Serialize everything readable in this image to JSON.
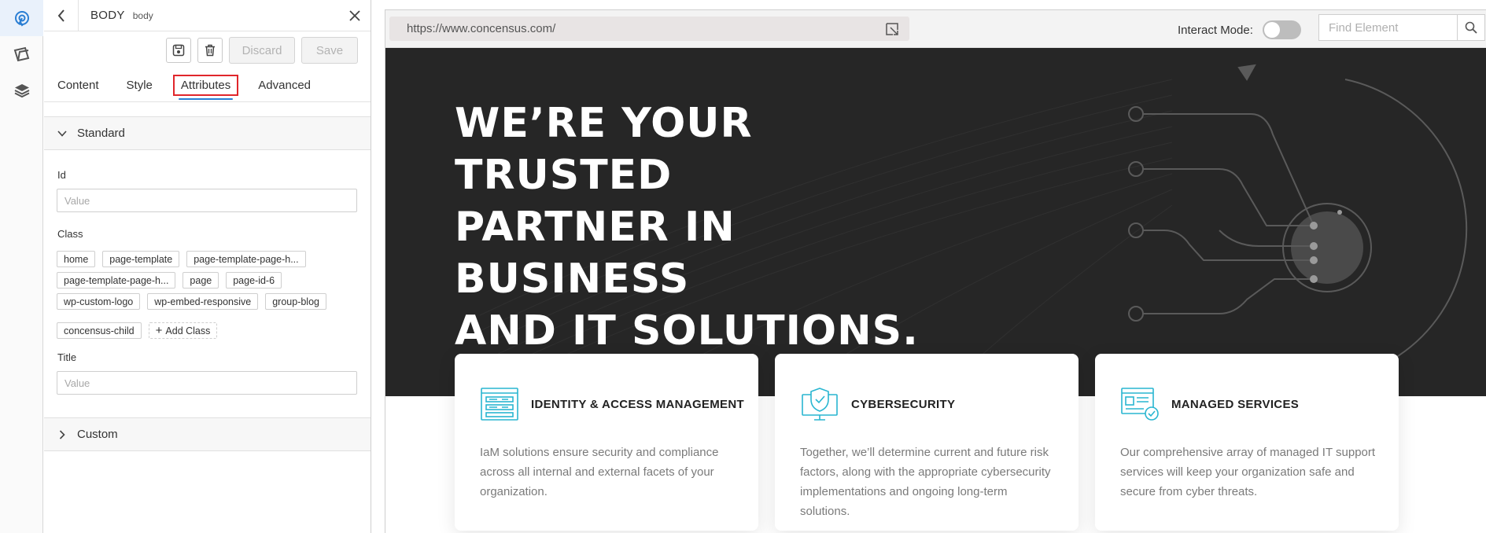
{
  "rail": {
    "items": [
      {
        "icon": "selector-icon"
      },
      {
        "icon": "pages-icon"
      },
      {
        "icon": "layers-icon"
      }
    ]
  },
  "panel": {
    "tag_name": "BODY",
    "tag_sub": "body",
    "toolbar": {
      "discard_label": "Discard",
      "save_label": "Save"
    },
    "tabs": [
      "Content",
      "Style",
      "Attributes",
      "Advanced"
    ],
    "active_tab": "Attributes",
    "standard_label": "Standard",
    "id_label": "Id",
    "id_placeholder": "Value",
    "class_label": "Class",
    "classes": [
      "home",
      "page-template",
      "page-template-page-h...",
      "page-template-page-h...",
      "page",
      "page-id-6",
      "wp-custom-logo",
      "wp-embed-responsive",
      "group-blog",
      "concensus-child"
    ],
    "add_class_label": "Add Class",
    "title_label": "Title",
    "title_placeholder": "Value",
    "custom_label": "Custom"
  },
  "browser": {
    "url": "https://www.concensus.com/",
    "interact_label": "Interact Mode",
    "interact_on": false,
    "find_placeholder": "Find Element"
  },
  "site": {
    "hero_lines": [
      "WE’RE YOUR TRUSTED",
      "PARTNER IN BUSINESS",
      "AND IT SOLUTIONS."
    ],
    "cards": [
      {
        "icon": "identity-access-icon",
        "title": "IDENTITY & ACCESS MANAGEMENT",
        "text": "IaM solutions ensure security and compliance across all internal and external facets of your organization."
      },
      {
        "icon": "cybersecurity-shield-icon",
        "title": "CYBERSECURITY",
        "text": "Together, we’ll determine current and future risk factors, along with the appropriate cybersecurity implementations and ongoing long-term solutions."
      },
      {
        "icon": "managed-services-icon",
        "title": "MANAGED SERVICES",
        "text": "Our comprehensive array of managed IT support services will keep your organization safe and secure from cyber threats."
      }
    ]
  },
  "colors": {
    "accent": "#2a7ed3",
    "highlight_box": "#e0262b",
    "hero_bg": "#262626",
    "card_icon": "#29b6d1"
  }
}
